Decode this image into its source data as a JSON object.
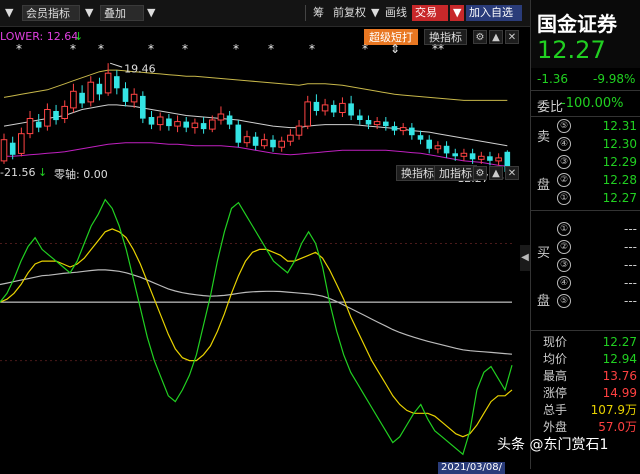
{
  "toolbar": {
    "items": [
      "▼",
      "会员指标",
      "▼",
      "叠加",
      "▼",
      "筹",
      "前复权",
      "▼",
      "画线",
      "交易",
      "▼",
      "加入自选"
    ]
  },
  "main_chart": {
    "indicator_label": "LOWER: 12.64",
    "indicator_arrow": "↓",
    "super_short_btn": "超级短打",
    "switch_btn": "换指标",
    "annotation_high": "19.46",
    "annotation_low": "12.27",
    "star_marks": [
      "*",
      "*",
      "*",
      "*",
      "*",
      "*",
      "*",
      "*",
      "*",
      "⇕",
      "**"
    ]
  },
  "sub_chart": {
    "value_label": "-21.56",
    "value_arrow": "↓",
    "zero_axis_label": "零轴: 0.00",
    "switch_btn": "换指标",
    "add_btn": "加指标"
  },
  "chart_data": {
    "type": "candlestick",
    "candles": [
      {
        "o": 13.0,
        "c": 14.4,
        "h": 14.8,
        "l": 12.8,
        "up": true
      },
      {
        "o": 14.2,
        "c": 13.4,
        "h": 14.6,
        "l": 13.1,
        "up": false
      },
      {
        "o": 13.5,
        "c": 14.8,
        "h": 15.2,
        "l": 13.3,
        "up": true
      },
      {
        "o": 14.8,
        "c": 15.8,
        "h": 16.3,
        "l": 14.5,
        "up": true
      },
      {
        "o": 15.6,
        "c": 15.2,
        "h": 16.1,
        "l": 14.9,
        "up": false
      },
      {
        "o": 15.3,
        "c": 16.4,
        "h": 16.8,
        "l": 15.0,
        "up": true
      },
      {
        "o": 16.3,
        "c": 15.7,
        "h": 16.7,
        "l": 15.4,
        "up": false
      },
      {
        "o": 15.8,
        "c": 16.6,
        "h": 17.0,
        "l": 15.5,
        "up": true
      },
      {
        "o": 16.5,
        "c": 17.6,
        "h": 18.1,
        "l": 16.2,
        "up": true
      },
      {
        "o": 17.5,
        "c": 16.8,
        "h": 18.0,
        "l": 16.5,
        "up": false
      },
      {
        "o": 16.9,
        "c": 18.2,
        "h": 18.6,
        "l": 16.6,
        "up": true
      },
      {
        "o": 18.1,
        "c": 17.4,
        "h": 18.5,
        "l": 17.0,
        "up": false
      },
      {
        "o": 17.5,
        "c": 18.8,
        "h": 19.46,
        "l": 17.3,
        "up": true
      },
      {
        "o": 18.6,
        "c": 17.8,
        "h": 19.0,
        "l": 17.4,
        "up": false
      },
      {
        "o": 17.8,
        "c": 16.9,
        "h": 18.2,
        "l": 16.6,
        "up": false
      },
      {
        "o": 16.9,
        "c": 17.4,
        "h": 17.8,
        "l": 16.5,
        "up": true
      },
      {
        "o": 17.3,
        "c": 15.8,
        "h": 17.6,
        "l": 15.5,
        "up": false
      },
      {
        "o": 15.9,
        "c": 15.4,
        "h": 16.3,
        "l": 15.1,
        "up": false
      },
      {
        "o": 15.4,
        "c": 15.9,
        "h": 16.2,
        "l": 15.0,
        "up": true
      },
      {
        "o": 15.8,
        "c": 15.3,
        "h": 16.1,
        "l": 15.0,
        "up": false
      },
      {
        "o": 15.3,
        "c": 15.6,
        "h": 16.0,
        "l": 14.9,
        "up": true
      },
      {
        "o": 15.6,
        "c": 15.2,
        "h": 15.9,
        "l": 14.9,
        "up": false
      },
      {
        "o": 15.2,
        "c": 15.5,
        "h": 15.8,
        "l": 14.8,
        "up": true
      },
      {
        "o": 15.5,
        "c": 15.1,
        "h": 15.9,
        "l": 14.8,
        "up": false
      },
      {
        "o": 15.1,
        "c": 15.7,
        "h": 16.0,
        "l": 14.9,
        "up": true
      },
      {
        "o": 15.7,
        "c": 16.1,
        "h": 16.6,
        "l": 15.4,
        "up": true
      },
      {
        "o": 16.0,
        "c": 15.4,
        "h": 16.3,
        "l": 15.1,
        "up": false
      },
      {
        "o": 15.4,
        "c": 14.2,
        "h": 15.7,
        "l": 13.9,
        "up": false
      },
      {
        "o": 14.2,
        "c": 14.6,
        "h": 15.0,
        "l": 13.9,
        "up": true
      },
      {
        "o": 14.6,
        "c": 14.0,
        "h": 14.9,
        "l": 13.7,
        "up": false
      },
      {
        "o": 14.0,
        "c": 14.4,
        "h": 14.8,
        "l": 13.8,
        "up": true
      },
      {
        "o": 14.4,
        "c": 13.9,
        "h": 14.7,
        "l": 13.6,
        "up": false
      },
      {
        "o": 13.9,
        "c": 14.3,
        "h": 14.6,
        "l": 13.6,
        "up": true
      },
      {
        "o": 14.3,
        "c": 14.7,
        "h": 15.1,
        "l": 14.0,
        "up": true
      },
      {
        "o": 14.7,
        "c": 15.3,
        "h": 15.7,
        "l": 14.4,
        "up": true
      },
      {
        "o": 15.3,
        "c": 16.9,
        "h": 17.3,
        "l": 15.1,
        "up": true
      },
      {
        "o": 16.9,
        "c": 16.3,
        "h": 17.4,
        "l": 16.0,
        "up": false
      },
      {
        "o": 16.3,
        "c": 16.7,
        "h": 17.1,
        "l": 16.0,
        "up": true
      },
      {
        "o": 16.7,
        "c": 16.2,
        "h": 17.0,
        "l": 15.9,
        "up": false
      },
      {
        "o": 16.2,
        "c": 16.8,
        "h": 17.2,
        "l": 15.9,
        "up": true
      },
      {
        "o": 16.8,
        "c": 16.0,
        "h": 17.3,
        "l": 15.7,
        "up": false
      },
      {
        "o": 16.0,
        "c": 15.7,
        "h": 16.4,
        "l": 15.4,
        "up": false
      },
      {
        "o": 15.7,
        "c": 15.4,
        "h": 16.0,
        "l": 15.1,
        "up": false
      },
      {
        "o": 15.4,
        "c": 15.6,
        "h": 15.9,
        "l": 15.1,
        "up": true
      },
      {
        "o": 15.6,
        "c": 15.3,
        "h": 15.9,
        "l": 15.0,
        "up": false
      },
      {
        "o": 15.3,
        "c": 15.0,
        "h": 15.6,
        "l": 14.7,
        "up": false
      },
      {
        "o": 15.0,
        "c": 15.2,
        "h": 15.5,
        "l": 14.7,
        "up": true
      },
      {
        "o": 15.2,
        "c": 14.7,
        "h": 15.5,
        "l": 14.4,
        "up": false
      },
      {
        "o": 14.7,
        "c": 14.4,
        "h": 15.0,
        "l": 14.1,
        "up": false
      },
      {
        "o": 14.4,
        "c": 13.8,
        "h": 14.7,
        "l": 13.5,
        "up": false
      },
      {
        "o": 13.8,
        "c": 14.0,
        "h": 14.3,
        "l": 13.5,
        "up": true
      },
      {
        "o": 14.0,
        "c": 13.5,
        "h": 14.3,
        "l": 13.2,
        "up": false
      },
      {
        "o": 13.5,
        "c": 13.3,
        "h": 13.8,
        "l": 13.0,
        "up": false
      },
      {
        "o": 13.3,
        "c": 13.5,
        "h": 13.8,
        "l": 13.0,
        "up": true
      },
      {
        "o": 13.5,
        "c": 13.1,
        "h": 13.8,
        "l": 12.8,
        "up": false
      },
      {
        "o": 13.1,
        "c": 13.3,
        "h": 13.6,
        "l": 12.8,
        "up": true
      },
      {
        "o": 13.3,
        "c": 13.0,
        "h": 13.6,
        "l": 12.7,
        "up": false
      },
      {
        "o": 13.0,
        "c": 13.2,
        "h": 13.5,
        "l": 12.7,
        "up": true
      },
      {
        "o": 13.6,
        "c": 12.27,
        "h": 13.7,
        "l": 12.27,
        "up": false
      }
    ],
    "upper_band": [
      17.2,
      17.3,
      17.4,
      17.5,
      17.6,
      17.7,
      17.9,
      18.1,
      18.3,
      18.5,
      18.7,
      18.9,
      19.0,
      19.0,
      18.95,
      18.9,
      18.85,
      18.8,
      18.75,
      18.7,
      18.65,
      18.6,
      18.6,
      18.55,
      18.5,
      18.45,
      18.4,
      18.35,
      18.3,
      18.25,
      18.2,
      18.15,
      18.1,
      18.05,
      18.0,
      18.1,
      18.1,
      18.1,
      18.05,
      18.0,
      17.9,
      17.8,
      17.7,
      17.6,
      17.5,
      17.4,
      17.35,
      17.3,
      17.25,
      17.2,
      17.15,
      17.1,
      17.05,
      17.0,
      17.0,
      17.0,
      17.0,
      17.0,
      17.0
    ],
    "mid_band": [
      15.3,
      15.4,
      15.5,
      15.6,
      15.7,
      15.8,
      15.9,
      16.0,
      16.2,
      16.4,
      16.5,
      16.6,
      16.7,
      16.7,
      16.65,
      16.6,
      16.5,
      16.4,
      16.3,
      16.2,
      16.1,
      16.0,
      15.95,
      15.9,
      15.85,
      15.8,
      15.75,
      15.7,
      15.6,
      15.5,
      15.4,
      15.3,
      15.25,
      15.2,
      15.2,
      15.3,
      15.35,
      15.4,
      15.4,
      15.4,
      15.4,
      15.35,
      15.3,
      15.25,
      15.2,
      15.15,
      15.1,
      15.0,
      14.95,
      14.9,
      14.8,
      14.7,
      14.6,
      14.5,
      14.4,
      14.3,
      14.2,
      14.1,
      14.0
    ],
    "lower_band": [
      13.3,
      13.3,
      13.35,
      13.4,
      13.45,
      13.5,
      13.55,
      13.6,
      13.7,
      13.8,
      13.9,
      14.0,
      14.1,
      14.15,
      14.2,
      14.2,
      14.2,
      14.2,
      14.15,
      14.1,
      14.1,
      14.05,
      14.0,
      14.0,
      14.0,
      14.0,
      13.95,
      13.9,
      13.8,
      13.7,
      13.6,
      13.5,
      13.45,
      13.4,
      13.45,
      13.5,
      13.55,
      13.6,
      13.65,
      13.7,
      13.7,
      13.7,
      13.7,
      13.7,
      13.7,
      13.65,
      13.6,
      13.55,
      13.5,
      13.4,
      13.3,
      13.2,
      13.1,
      13.0,
      12.95,
      12.9,
      12.8,
      12.7,
      12.64
    ],
    "osc_green": [
      0,
      3,
      8,
      14,
      19,
      22,
      18,
      16,
      14,
      12,
      10,
      14,
      20,
      26,
      30,
      35,
      32,
      26,
      18,
      8,
      -2,
      -12,
      -20,
      -26,
      -32,
      -34,
      -30,
      -25,
      -18,
      -8,
      2,
      14,
      24,
      32,
      34,
      30,
      26,
      22,
      18,
      14,
      12,
      10,
      14,
      20,
      24,
      20,
      12,
      0,
      -10,
      -18,
      -24,
      -28,
      -32,
      -36,
      -40,
      -44,
      -48,
      -46,
      -42,
      -38,
      -35,
      -40,
      -44,
      -46,
      -48,
      -50,
      -52,
      -44,
      -30,
      -24,
      -22,
      -26,
      -30,
      -21.56
    ],
    "osc_yellow": [
      0,
      1,
      3,
      6,
      10,
      13,
      14,
      14,
      14,
      13,
      12,
      13,
      15,
      18,
      21,
      24,
      25,
      24,
      22,
      18,
      13,
      7,
      1,
      -5,
      -11,
      -16,
      -19,
      -20,
      -20,
      -18,
      -15,
      -10,
      -4,
      3,
      9,
      14,
      17,
      18,
      18,
      17,
      16,
      14,
      14,
      15,
      16,
      17,
      15,
      11,
      6,
      1,
      -5,
      -10,
      -15,
      -20,
      -24,
      -28,
      -32,
      -35,
      -37,
      -38,
      -38,
      -38,
      -39,
      -41,
      -43,
      -45,
      -46,
      -45,
      -42,
      -38,
      -34,
      -32,
      -32,
      -30
    ],
    "osc_white": [
      6,
      6.5,
      7,
      7.5,
      8,
      8.5,
      9,
      9.2,
      9.5,
      9.8,
      10,
      10.2,
      10.5,
      10.8,
      11,
      11,
      10.8,
      10.5,
      10,
      9.3,
      8.5,
      7.5,
      6.5,
      5.5,
      4.5,
      3.8,
      3.2,
      2.8,
      2.5,
      2.2,
      2,
      2.1,
      2.3,
      2.6,
      3,
      3.3,
      3.5,
      3.6,
      3.7,
      3.7,
      3.6,
      3.4,
      3.2,
      3,
      2.8,
      2.5,
      2,
      1.2,
      0.2,
      -1,
      -2.2,
      -3.4,
      -4.6,
      -5.8,
      -7,
      -8.2,
      -9.4,
      -10.4,
      -11.2,
      -12,
      -12.7,
      -13.4,
      -14,
      -14.6,
      -15.2,
      -15.8,
      -16.3,
      -16.6,
      -16.8,
      -17,
      -17.2,
      -17.4,
      -17.6,
      -17.8
    ]
  },
  "panel": {
    "title": "国金证券",
    "price": "12.27",
    "change": "-1.36",
    "change_pct": "-9.98%",
    "ratio_label": "委比",
    "ratio_value": "-100.00%",
    "sell_side_1": "卖",
    "sell_side_2": "盘",
    "buy_side_1": "买",
    "buy_side_2": "盘",
    "sell_levels": [
      {
        "lvl": "⑤",
        "val": "12.31"
      },
      {
        "lvl": "④",
        "val": "12.30"
      },
      {
        "lvl": "③",
        "val": "12.29"
      },
      {
        "lvl": "②",
        "val": "12.28"
      },
      {
        "lvl": "①",
        "val": "12.27"
      }
    ],
    "buy_levels": [
      {
        "lvl": "①",
        "val": "---"
      },
      {
        "lvl": "②",
        "val": "---"
      },
      {
        "lvl": "③",
        "val": "---"
      },
      {
        "lvl": "④",
        "val": "---"
      },
      {
        "lvl": "⑤",
        "val": "---"
      }
    ],
    "stats": [
      {
        "k": "现价",
        "v": "12.27",
        "color": "#21d021"
      },
      {
        "k": "均价",
        "v": "12.94",
        "color": "#21d021"
      },
      {
        "k": "最高",
        "v": "13.76",
        "color": "#ff4040"
      },
      {
        "k": "涨停",
        "v": "14.99",
        "color": "#ff4040"
      },
      {
        "k": "总手",
        "v": "107.9万",
        "color": "#e8d200"
      },
      {
        "k": "外盘",
        "v": "57.0万",
        "color": "#ff4040"
      }
    ]
  },
  "watermark": "头条 @东门赏石1",
  "date_label": "2021/03/08/"
}
